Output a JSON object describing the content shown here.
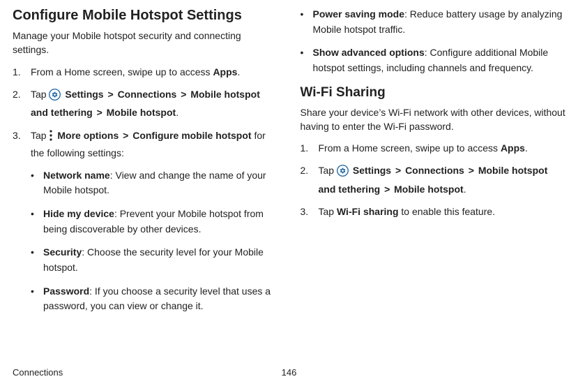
{
  "left": {
    "title": "Configure Mobile Hotspot Settings",
    "desc": "Manage your Mobile hotspot security and connecting settings.",
    "step1_a": "From a Home screen, swipe up to access ",
    "step1_b": "Apps",
    "step1_c": ".",
    "step2_a": "Tap ",
    "step2_settings": "Settings",
    "step2_connections": "Connections",
    "step2_mht": "Mobile hotspot and tethering",
    "step2_mh": "Mobile hotspot",
    "step2_end": ".",
    "gt": ">",
    "step3_a": "Tap ",
    "step3_more": "More options",
    "step3_cfg": "Configure mobile hotspot",
    "step3_tail": " for the following settings:",
    "bul": {
      "net_t": "Network name",
      "net_d": ": View and change the name of your Mobile hotspot.",
      "hide_t": "Hide my device",
      "hide_d": ": Prevent your Mobile hotspot from being discoverable by other devices.",
      "sec_t": "Security",
      "sec_d": ": Choose the security level for your Mobile hotspot.",
      "pwd_t": "Password",
      "pwd_d": ": If you choose a security level that uses a password, you can view or change it."
    }
  },
  "right": {
    "bul": {
      "psm_t": "Power saving mode",
      "psm_d": ": Reduce battery usage by analyzing Mobile hotspot traffic.",
      "adv_t": "Show advanced options",
      "adv_d": ": Configure additional Mobile hotspot settings, including channels and frequency."
    },
    "title": "Wi-Fi Sharing",
    "desc": "Share your device’s Wi-Fi network with other devices, without having to enter the Wi-Fi password.",
    "step1_a": "From a Home screen, swipe up to access ",
    "step1_b": "Apps",
    "step1_c": ".",
    "step2_a": "Tap ",
    "step2_settings": "Settings",
    "step2_connections": "Connections",
    "step2_mht": "Mobile hotspot and tethering",
    "step2_mh": "Mobile hotspot",
    "step2_end": ".",
    "gt": ">",
    "step3_a": "Tap ",
    "step3_b": "Wi-Fi sharing",
    "step3_c": " to enable this feature."
  },
  "footer": {
    "section": "Connections",
    "page": "146"
  }
}
